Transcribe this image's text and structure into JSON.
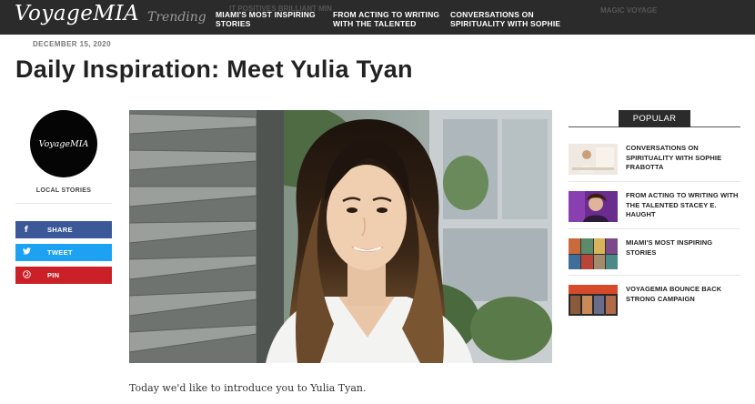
{
  "header": {
    "logo": "VoyageMIA",
    "trending_label": "Trending",
    "nav_items": [
      "MIAMI'S MOST INSPIRING STORIES",
      "FROM ACTING TO WRITING WITH THE TALENTED",
      "CONVERSATIONS ON SPIRITUALITY WITH SOPHIE"
    ],
    "faded_items": [
      "IT POSITIVES BRILLIANT MIN",
      "MAGIC VOYAGE"
    ]
  },
  "article": {
    "date": "DECEMBER 15, 2020",
    "title": "Daily Inspiration: Meet Yulia Tyan",
    "intro": "Today we'd like to introduce you to Yulia Tyan."
  },
  "sidebar_left": {
    "avatar_text": "VoyageMIA",
    "category": "LOCAL STORIES",
    "share_buttons": [
      {
        "label": "SHARE",
        "icon": "facebook-icon",
        "color": "#3b5998"
      },
      {
        "label": "TWEET",
        "icon": "twitter-icon",
        "color": "#1da1f2"
      },
      {
        "label": "PIN",
        "icon": "pinterest-icon",
        "color": "#cb2027"
      }
    ]
  },
  "popular": {
    "heading": "POPULAR",
    "items": [
      {
        "title": "CONVERSATIONS ON SPIRITUALITY WITH SOPHIE FRABOTTA"
      },
      {
        "title": "FROM ACTING TO WRITING WITH THE TALENTED STACEY E. HAUGHT"
      },
      {
        "title": "MIAMI'S MOST INSPIRING STORIES"
      },
      {
        "title": "VOYAGEMIA BOUNCE BACK STRONG CAMPAIGN"
      }
    ]
  },
  "colors": {
    "topbar": "#2b2b2b",
    "facebook": "#3b5998",
    "twitter": "#1da1f2",
    "pinterest": "#cb2027"
  }
}
